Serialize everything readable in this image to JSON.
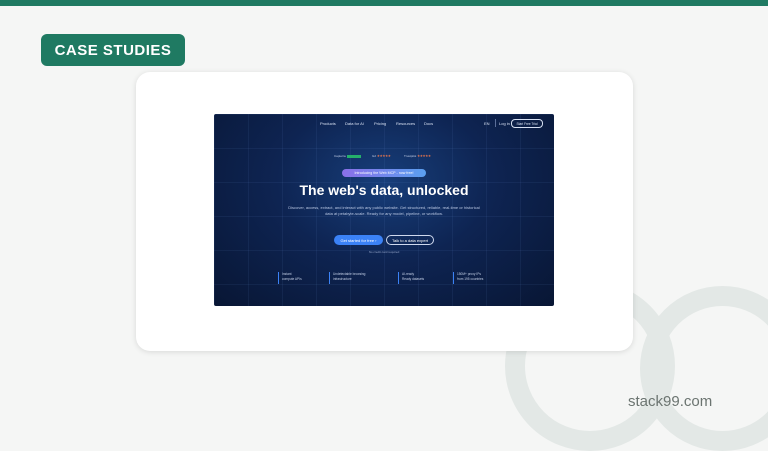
{
  "badge": {
    "label": "CASE STUDIES"
  },
  "brand": {
    "name": "stack99.com"
  },
  "colors": {
    "accent": "#1f7a62",
    "site_bg": "#0e2452",
    "cta": "#3b82f6"
  },
  "site": {
    "nav": {
      "items": [
        "Products",
        "Data for AI",
        "Pricing",
        "Resources",
        "Docs"
      ],
      "lang": "EN",
      "login": "Log in",
      "cta": "Start Free Trial"
    },
    "ratings": [
      {
        "label": "Capterra",
        "stars": "★★★★★"
      },
      {
        "label": "G2",
        "stars": "★★★★★"
      },
      {
        "label": "Trustpilot",
        "stars": "★★★★★"
      }
    ],
    "announcement": "Introducing the Web MCP - now free!",
    "headline": "The web's data, unlocked",
    "subtitle": "Discover, access, extract, and interact with any public website. Get structured, reliable, real-time or historical data at petabyte-scale. Ready for any model, pipeline, or workflow.",
    "primary_cta": "Get started for free ›",
    "secondary_cta": "Talk to a data expert",
    "note": "No credit card required",
    "features": [
      {
        "line1": "Instant",
        "line2": "compute APIs"
      },
      {
        "line1": "Undetectable browsing",
        "line2": "infrastructure"
      },
      {
        "line1": "AI-ready",
        "line2": "Ready datasets"
      },
      {
        "line1": "150M+ proxy IPs",
        "line2": "from 195 countries"
      }
    ]
  }
}
